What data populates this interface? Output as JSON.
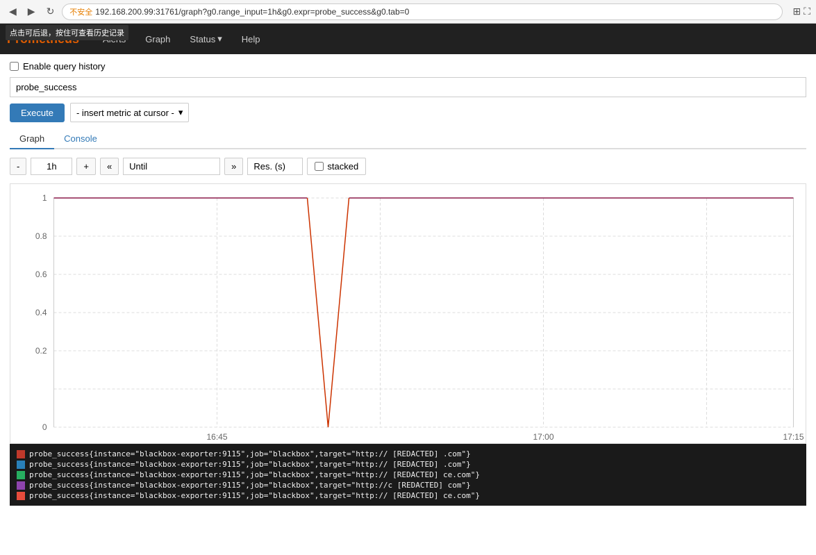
{
  "browser": {
    "back_icon": "◀",
    "forward_icon": "▶",
    "reload_icon": "↻",
    "security_label": "不安全",
    "address": "192.168.200.99:31761/graph?g0.range_input=1h&g0.expr=probe_success&g0.tab=0",
    "grid_icon": "⊞",
    "expand_icon": "⛶",
    "tooltip": "点击可后退，按住可查看历史记录"
  },
  "navbar": {
    "brand": "Prometheus",
    "items": [
      "Alerts",
      "Graph",
      "Status",
      "Help"
    ],
    "status_has_dropdown": true
  },
  "query_history": {
    "label": "Enable query history",
    "checked": false
  },
  "query": {
    "value": "probe_success",
    "placeholder": ""
  },
  "execute": {
    "label": "Execute",
    "metric_selector_label": "- insert metric at cursor -",
    "dropdown_icon": "▾"
  },
  "tabs": [
    {
      "label": "Graph",
      "active": true
    },
    {
      "label": "Console",
      "active": false
    }
  ],
  "graph_controls": {
    "minus": "-",
    "range": "1h",
    "plus": "+",
    "back": "«",
    "until_placeholder": "Until",
    "forward": "»",
    "res_placeholder": "Res. (s)",
    "stacked_label": "stacked",
    "stacked_checked": false
  },
  "graph": {
    "y_labels": [
      "1",
      "0.8",
      "0.6",
      "0.4",
      "0.2",
      "0"
    ],
    "x_labels": [
      "16:45",
      "17:00",
      "17:15"
    ],
    "line_color": "#8B1A4A",
    "dip_color": "#cc3300",
    "accent": "#337ab7"
  },
  "legend": {
    "items": [
      {
        "color": "#c0392b",
        "text": "probe_success{instance=\"blackbox-exporter:9115\",job=\"blackbox\",target=\"http:// [REDACTED] .com\"}"
      },
      {
        "color": "#2980b9",
        "text": "probe_success{instance=\"blackbox-exporter:9115\",job=\"blackbox\",target=\"http:// [REDACTED] .com\"}"
      },
      {
        "color": "#27ae60",
        "text": "probe_success{instance=\"blackbox-exporter:9115\",job=\"blackbox\",target=\"http:// [REDACTED] ce.com\"}"
      },
      {
        "color": "#8e44ad",
        "text": "probe_success{instance=\"blackbox-exporter:9115\",job=\"blackbox\",target=\"http://c [REDACTED] com\"}"
      },
      {
        "color": "#e74c3c",
        "text": "probe_success{instance=\"blackbox-exporter:9115\",job=\"blackbox\",target=\"http:// [REDACTED] ce.com\"}"
      }
    ]
  }
}
